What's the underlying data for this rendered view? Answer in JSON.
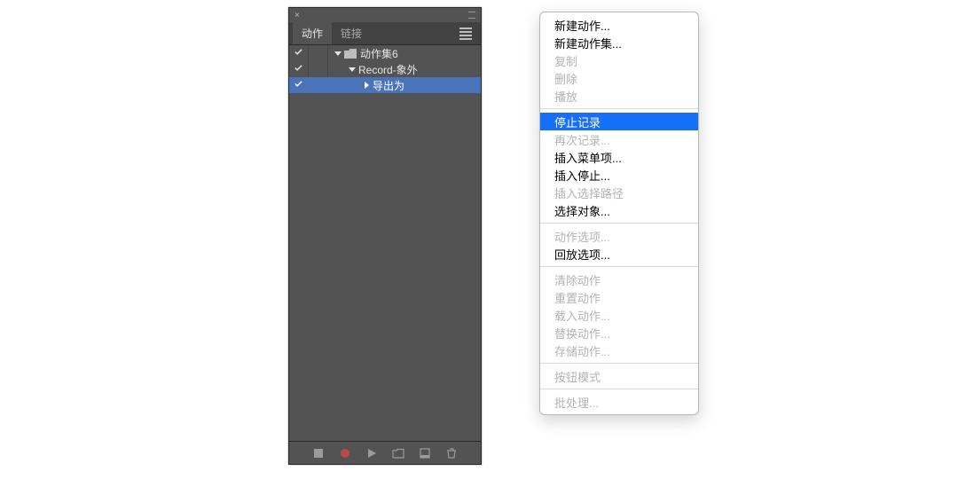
{
  "panel": {
    "close": "×",
    "tabs": [
      {
        "label": "动作",
        "active": true
      },
      {
        "label": "链接",
        "active": false
      }
    ],
    "rows": [
      {
        "checked": true,
        "indent": 0,
        "expanded": true,
        "folder": true,
        "label": "动作集6",
        "selected": false
      },
      {
        "checked": true,
        "indent": 1,
        "expanded": true,
        "folder": false,
        "label": "Record-象外",
        "selected": false
      },
      {
        "checked": true,
        "indent": 2,
        "expanded": false,
        "folder": false,
        "label": "导出为",
        "selected": true
      }
    ],
    "footer_icons": [
      "stop-icon",
      "record-icon",
      "play-icon",
      "new-set-icon",
      "new-action-icon",
      "trash-icon"
    ]
  },
  "menu": {
    "groups": [
      [
        {
          "label": "新建动作...",
          "enabled": true
        },
        {
          "label": "新建动作集...",
          "enabled": true
        },
        {
          "label": "复制",
          "enabled": false
        },
        {
          "label": "删除",
          "enabled": false
        },
        {
          "label": "播放",
          "enabled": false
        }
      ],
      [
        {
          "label": "停止记录",
          "enabled": true,
          "highlight": true
        },
        {
          "label": "再次记录...",
          "enabled": false
        },
        {
          "label": "插入菜单项...",
          "enabled": true
        },
        {
          "label": "插入停止...",
          "enabled": true
        },
        {
          "label": "插入选择路径",
          "enabled": false
        },
        {
          "label": "选择对象...",
          "enabled": true
        }
      ],
      [
        {
          "label": "动作选项...",
          "enabled": false
        },
        {
          "label": "回放选项...",
          "enabled": true
        }
      ],
      [
        {
          "label": "清除动作",
          "enabled": false
        },
        {
          "label": "重置动作",
          "enabled": false
        },
        {
          "label": "载入动作...",
          "enabled": false
        },
        {
          "label": "替换动作...",
          "enabled": false
        },
        {
          "label": "存储动作...",
          "enabled": false
        }
      ],
      [
        {
          "label": "按钮模式",
          "enabled": false
        }
      ],
      [
        {
          "label": "批处理...",
          "enabled": false
        }
      ]
    ]
  }
}
